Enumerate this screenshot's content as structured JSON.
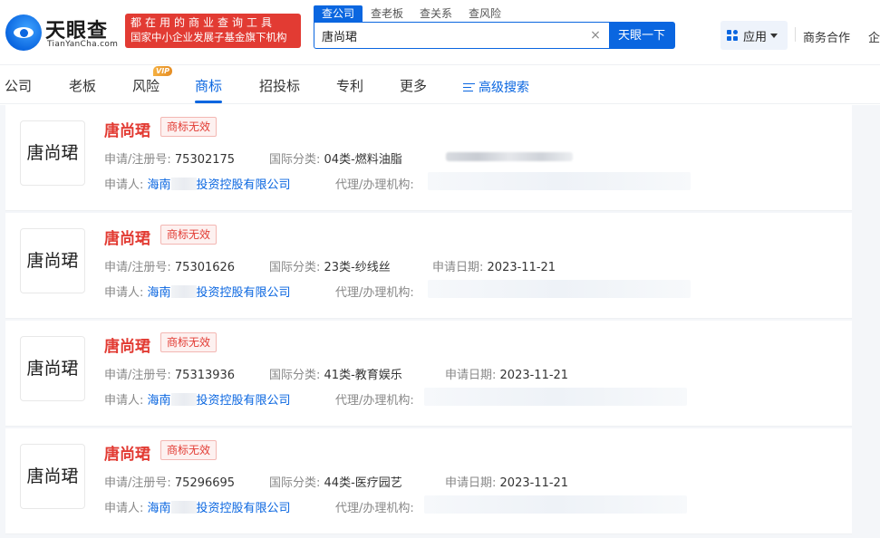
{
  "header": {
    "logo_cn": "天眼查",
    "logo_en": "TianYanCha.com",
    "slogan_line1": "都在用的商业查询工具",
    "slogan_line2": "国家中小企业发展子基金旗下机构",
    "search_tabs": [
      "查公司",
      "查老板",
      "查关系",
      "查风险"
    ],
    "search_value": "唐尚珺",
    "clear_glyph": "×",
    "search_button": "天眼一下",
    "apps_label": "应用",
    "biz_link": "商务合作",
    "biz_link2": "企"
  },
  "nav": {
    "items": [
      "公司",
      "老板",
      "风险",
      "商标",
      "招投标",
      "专利",
      "更多"
    ],
    "active": "商标",
    "vip": "VIP",
    "advanced": "高级搜索"
  },
  "labels": {
    "reg_no": "申请/注册号:",
    "intl_class": "国际分类:",
    "apply_date": "申请日期:",
    "applicant": "申请人:",
    "agent": "代理/办理机构:"
  },
  "accent_color": "#0a66e0",
  "status_color": "#e23b33",
  "trademarks": [
    {
      "image_text": "唐尚珺",
      "name": "唐尚珺",
      "status": "商标无效",
      "reg_no": "75302175",
      "class": "04类-燃料油脂",
      "date": "",
      "applicant_pre": "海南",
      "applicant_post": "投资控股有限公司"
    },
    {
      "image_text": "唐尚珺",
      "name": "唐尚珺",
      "status": "商标无效",
      "reg_no": "75301626",
      "class": "23类-纱线丝",
      "date": "2023-11-21",
      "applicant_pre": "海南",
      "applicant_post": "投资控股有限公司"
    },
    {
      "image_text": "唐尚珺",
      "name": "唐尚珺",
      "status": "商标无效",
      "reg_no": "75313936",
      "class": "41类-教育娱乐",
      "date": "2023-11-21",
      "applicant_pre": "海南",
      "applicant_post": "投资控股有限公司"
    },
    {
      "image_text": "唐尚珺",
      "name": "唐尚珺",
      "status": "商标无效",
      "reg_no": "75296695",
      "class": "44类-医疗园艺",
      "date": "2023-11-21",
      "applicant_pre": "海南",
      "applicant_post": "投资控股有限公司"
    }
  ]
}
